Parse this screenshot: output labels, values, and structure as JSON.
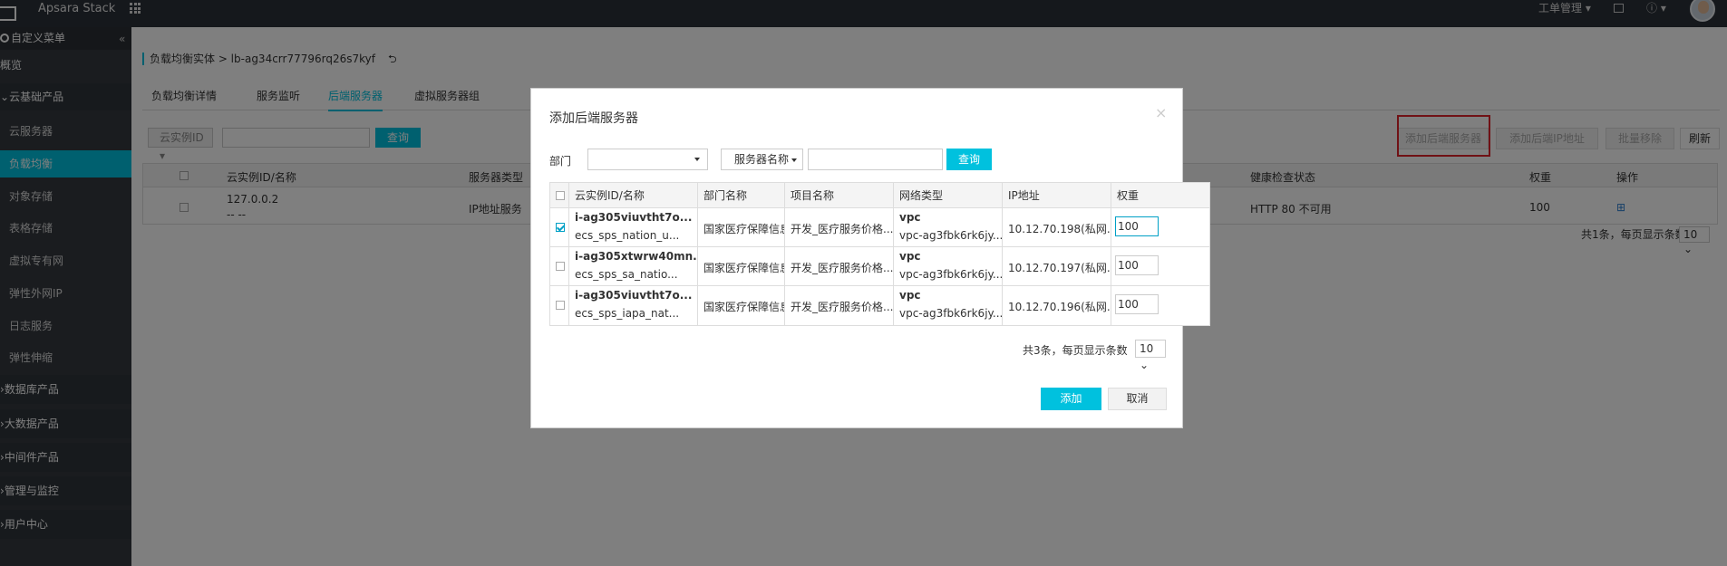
{
  "topbar": {
    "brand": "Apsara Stack",
    "workorder": "工单管理",
    "help": "?"
  },
  "sidebar": {
    "custom_menu": "自定义菜单",
    "items": [
      {
        "label": "概览"
      },
      {
        "label": "云基础产品"
      },
      {
        "label": "云服务器"
      },
      {
        "label": "负载均衡"
      },
      {
        "label": "对象存储"
      },
      {
        "label": "表格存储"
      },
      {
        "label": "虚拟专有网"
      },
      {
        "label": "弹性外网IP"
      },
      {
        "label": "日志服务"
      },
      {
        "label": "弹性伸缩"
      },
      {
        "label": "数据库产品"
      },
      {
        "label": "大数据产品"
      },
      {
        "label": "中间件产品"
      },
      {
        "label": "管理与监控"
      },
      {
        "label": "用户中心"
      }
    ]
  },
  "breadcrumb": {
    "text": "负载均衡实体 > lb-ag34crr77796rq26s7kyf",
    "back": "⮌"
  },
  "tabs": [
    "负载均衡详情",
    "服务监听",
    "后端服务器",
    "虚拟服务器组"
  ],
  "filter": {
    "select_label": "云实例ID",
    "search_button": "查询"
  },
  "actions": {
    "add_backend": "添加后端服务器",
    "add_ip": "添加后端IP地址",
    "batch_remove": "批量移除",
    "refresh": "刷新"
  },
  "bg_table": {
    "headers": [
      "云实例ID/名称",
      "服务器类型",
      "健康检查状态",
      "权重",
      "操作"
    ],
    "row": {
      "id": "127.0.0.2",
      "name": "-- --",
      "type": "IP地址服务",
      "health": "HTTP 80 不可用",
      "weight": "100"
    }
  },
  "bg_pager": {
    "text": "共1条，每页显示条数",
    "size": "10"
  },
  "modal": {
    "title": "添加后端服务器",
    "close": "×",
    "dept_label": "部门",
    "name_select": "服务器名称",
    "search_button": "查询",
    "headers": [
      "云实例ID/名称",
      "部门名称",
      "项目名称",
      "网络类型",
      "IP地址",
      "权重"
    ],
    "rows": [
      {
        "id": "i-ag305viuvtht7o...",
        "name": "ecs_sps_nation_u...",
        "dept": "国家医疗保障信息...",
        "project": "开发_医疗服务价格...",
        "net_type": "vpc",
        "vpc": "vpc-ag3fbk6rk6jy...",
        "ip": "10.12.70.198(私网...",
        "weight": "100",
        "checked": true
      },
      {
        "id": "i-ag305xtwrw40mn...",
        "name": "ecs_sps_sa_natio...",
        "dept": "国家医疗保障信息...",
        "project": "开发_医疗服务价格...",
        "net_type": "vpc",
        "vpc": "vpc-ag3fbk6rk6jy...",
        "ip": "10.12.70.197(私网...",
        "weight": "100",
        "checked": false
      },
      {
        "id": "i-ag305viuvtht7o...",
        "name": "ecs_sps_iapa_nat...",
        "dept": "国家医疗保障信息...",
        "project": "开发_医疗服务价格...",
        "net_type": "vpc",
        "vpc": "vpc-ag3fbk6rk6jy...",
        "ip": "10.12.70.196(私网...",
        "weight": "100",
        "checked": false
      }
    ],
    "pager_text": "共3条，每页显示条数",
    "pager_size": "10",
    "add_button": "添加",
    "cancel_button": "取消"
  }
}
